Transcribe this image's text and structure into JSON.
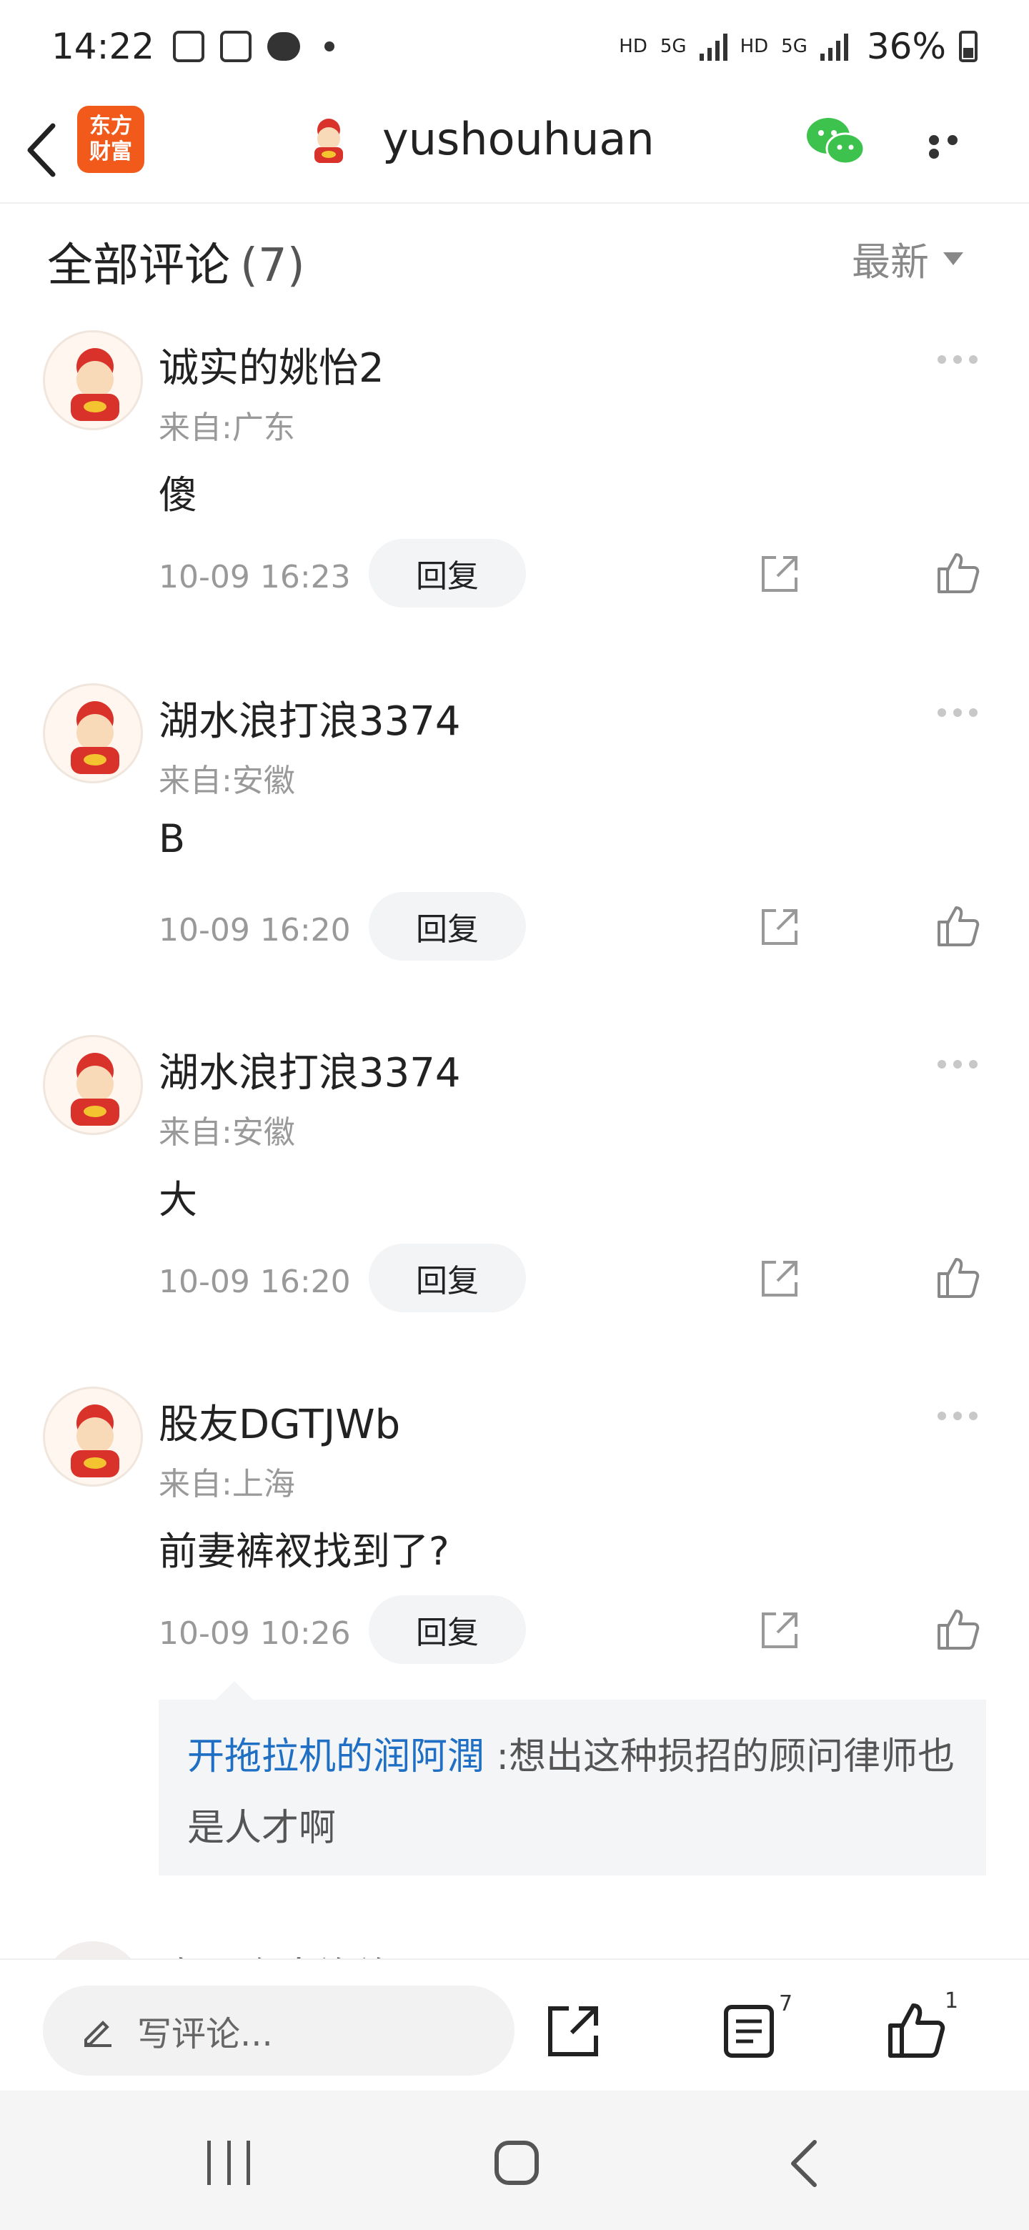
{
  "status_bar": {
    "time": "14:22",
    "network_labels": [
      "HD",
      "5G",
      "HD",
      "5G"
    ],
    "battery_percent": "36%"
  },
  "header": {
    "brand_logo_line1": "东方",
    "brand_logo_line2": "财富",
    "title": "yushouhuan",
    "icons": [
      "back-icon",
      "wechat-icon",
      "more-icon"
    ]
  },
  "comments_header": {
    "title": "全部评论",
    "count": "(7)",
    "sort_label": "最新"
  },
  "comments": [
    {
      "name": "诚实的姚怡2",
      "region": "来自:广东",
      "text": "傻",
      "time": "10-09 16:23",
      "reply_label": "回复"
    },
    {
      "name": "湖水浪打浪3374",
      "region": "来自:安徽",
      "text": "B",
      "time": "10-09 16:20",
      "reply_label": "回复"
    },
    {
      "name": "湖水浪打浪3374",
      "region": "来自:安徽",
      "text": "大",
      "time": "10-09 16:20",
      "reply_label": "回复"
    },
    {
      "name": "股友DGTJWb",
      "region": "来自:上海",
      "text": "前妻裤衩找到了?",
      "time": "10-09 10:26",
      "reply_label": "回复"
    }
  ],
  "sub_reply": {
    "author": "开拖拉机的润阿潤",
    "separator": ":",
    "text": "想出这种损招的顾问律师也是人才啊"
  },
  "partial_next_comment": {
    "name": "吹一会大泡泡"
  },
  "bottom_bar": {
    "input_placeholder": "写评论...",
    "comment_count": "7",
    "like_count": "1"
  },
  "colors": {
    "brand": "#f25a1c",
    "link_blue": "#1f6fc5",
    "wechat_green": "#3dc24d"
  }
}
